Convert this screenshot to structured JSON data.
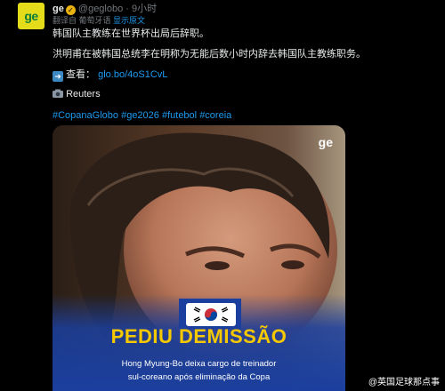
{
  "author": {
    "avatar_text": "ge",
    "name": "ge",
    "handle": "@geglobo",
    "separator": "·",
    "time": "9小时"
  },
  "translation_bar": {
    "label": "翻译自 葡萄牙语",
    "action": "显示原文"
  },
  "tweet": {
    "line1": "韩国队主教练在世界杯出局后辞职。",
    "line2": "洪明甫在被韩国总统李在明称为无能后数小时内辞去韩国队主教练职务。",
    "link_prefix": "查看：",
    "link": "glo.bo/4oS1CvL",
    "source": "Reuters",
    "hashtags": [
      "#CopanaGlobo",
      "#ge2026",
      "#futebol",
      "#coreia"
    ]
  },
  "media": {
    "logo": "ge",
    "headline": "PEDIU DEMISSÃO",
    "subtitle_line1": "Hong Myung-Bo deixa cargo de treinador",
    "subtitle_line2": "sul-coreano após eliminação da Copa",
    "colors": {
      "headline": "#f6c800",
      "panel": "#1b3f9e"
    }
  },
  "watermark": "@英国足球那点事"
}
